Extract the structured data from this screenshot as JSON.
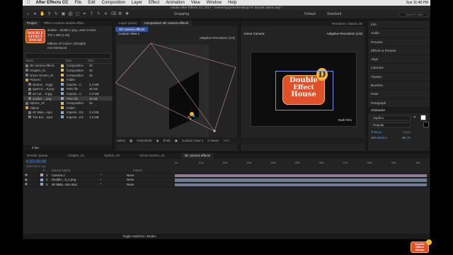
{
  "menubar": {
    "apple_icon": "apple-icon",
    "items": [
      "After Effects CC",
      "File",
      "Edit",
      "Composition",
      "Layer",
      "Effect",
      "Animation",
      "View",
      "Window",
      "Help"
    ],
    "status": "Sun 11:48 PM"
  },
  "window": {
    "title": "Adobe After Effects CC 2017 - /Users/nguyenv/Desktop/AF tutorial videos.aep *"
  },
  "toolbar": {
    "snapping_label": "Snapping",
    "workspace_default": "Default",
    "workspace_standard": "Standard",
    "search_placeholder": "Search Help"
  },
  "project_panel": {
    "tabs": [
      "Project",
      "Effect Controls double-effect"
    ],
    "preview_filename": "double-...0x280-1.png",
    "preview_used": ", used 2 times",
    "preview_dims": "370 x 280 (1.00)",
    "preview_color": "Millions of Colors+ (Straight)",
    "preview_interlace": "non-interlaced",
    "search_placeholder": "",
    "columns": [
      "Name",
      "Type",
      "Size"
    ],
    "rows": [
      {
        "name": "3D camera effects",
        "type": "Composition",
        "size": "25",
        "color": "#d9c47a",
        "indent": 0,
        "selected": false
      },
      {
        "name": "Chapter_01",
        "type": "Composition",
        "size": "25",
        "color": "#d9c47a",
        "indent": 0,
        "selected": false
      },
      {
        "name": "Green Screen_01",
        "type": "Composition",
        "size": "25",
        "color": "#d9c47a",
        "indent": 0,
        "selected": false
      },
      {
        "name": "Pictures",
        "type": "Folder",
        "size": "",
        "color": "#e3b74a",
        "indent": 0,
        "selected": false
      },
      {
        "name": "abstrac...-9.jpg",
        "type": "Importe...C",
        "size": "2.2 MB",
        "color": "#8fa7c9",
        "indent": 1,
        "selected": false
      },
      {
        "name": "agent-a...-9.png",
        "type": "PNG file",
        "size": "36 KB",
        "color": "#8fa7c9",
        "indent": 1,
        "selected": false
      },
      {
        "name": "art-cal....-9.jpg",
        "type": "Importe...C",
        "size": "2.0 MB",
        "color": "#8fa7c9",
        "indent": 1,
        "selected": false
      },
      {
        "name": "double-....png",
        "type": "PNG file",
        "size": "19 KB",
        "color": "#8fa7c9",
        "indent": 1,
        "selected": true
      },
      {
        "name": "Sphere_02",
        "type": "Composition",
        "size": "25",
        "color": "#d9c47a",
        "indent": 0,
        "selected": false
      },
      {
        "name": "Videos",
        "type": "Folder",
        "size": "",
        "color": "#e3b74a",
        "indent": 0,
        "selected": false
      },
      {
        "name": "4K Mala...mp4",
        "type": "Importe...EX",
        "size": "3.4 MB",
        "color": "#8fa7c9",
        "indent": 1,
        "selected": false
      },
      {
        "name": "The Bor....mp4",
        "type": "Importe...EX",
        "size": "1.6 MB",
        "color": "#8fa7c9",
        "indent": 1,
        "selected": false
      }
    ],
    "footer_bpc": "8 bpc"
  },
  "left_viewer": {
    "tabs": [
      "Layer (none)",
      "Composition 3D camera effects"
    ],
    "subtab": "3D camera effects",
    "view_label": "Custom View 1",
    "resolution_label": "Adaptive Resolution (1/3)"
  },
  "right_viewer": {
    "view_label": "Active Camera",
    "resolution_label": "Adaptive Resolution (1/3)",
    "renderer_label": "Renderer:",
    "renderer_value": "Classic 3D",
    "logo_line1": "Double",
    "logo_line2": "Effect",
    "logo_line3": "House",
    "logo_badge": "D",
    "credit": "Ruth Film"
  },
  "viewer_footer": {
    "zoom": "(40%)",
    "timecode": "0;00;00;00",
    "resolution": "(Full)",
    "view": "Custom View 1",
    "views": "2 Views",
    "exposure": "+0.0"
  },
  "right_panel": {
    "items": [
      "Info",
      "Audio",
      "Preview",
      "Effects & Presets",
      "Align",
      "Libraries",
      "Tracker",
      "Brushes",
      "Paint",
      "Paragraph"
    ],
    "character_title": "Character",
    "font_name": "Zapfino",
    "font_style": "Regular",
    "font_size": "60 px",
    "leading": "5 px",
    "tracking_label": "Metrics",
    "tracking_value": "75"
  },
  "timeline": {
    "tabs": [
      "Render Queue",
      "Chapter_01",
      "Sphere_02",
      "Green Screen_01",
      "3D camera effects"
    ],
    "timecode": "0;00;00;00",
    "fps": "00000 (29.97 fps)",
    "columns": [
      "#",
      "Source Name",
      "Parent"
    ],
    "layers": [
      {
        "num": "1",
        "name": "Camera 1",
        "parent": "None",
        "color": "#c79bd1"
      },
      {
        "num": "2",
        "name": "Double-...0_1.png",
        "parent": "None",
        "color": "#8fa7c9"
      },
      {
        "num": "3",
        "name": "4K Mala...deo.mp4",
        "parent": "None",
        "color": "#8fa7c9"
      }
    ],
    "ruler": [
      "0s",
      "01s",
      "02s",
      "03s",
      "04s",
      "05s",
      "06s",
      "07s",
      "08s",
      "09s",
      "10s"
    ],
    "footer": "Toggle Switches / Modes"
  },
  "watermark": {
    "line1": "Double",
    "line2": "Effect",
    "line3": "House"
  }
}
